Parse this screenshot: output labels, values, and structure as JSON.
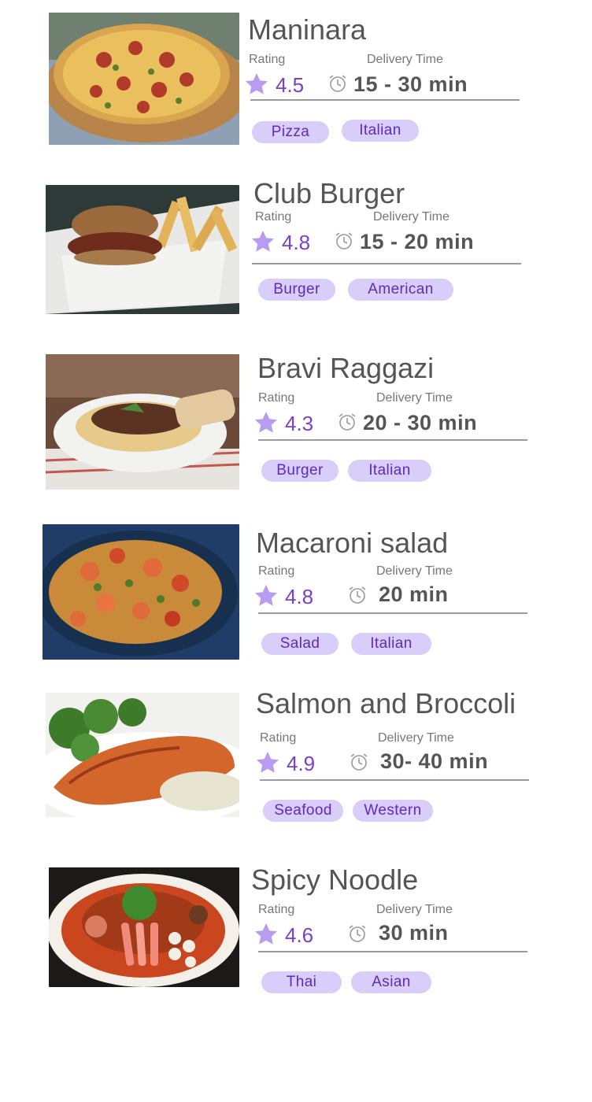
{
  "labels": {
    "rating": "Rating",
    "delivery": "Delivery Time"
  },
  "colors": {
    "accent": "#7a3fd0",
    "star": "#b79cf2",
    "tag_bg": "#d9cdfa",
    "tag_text": "#5d2cb8",
    "title": "#555555"
  },
  "restaurants": [
    {
      "name": "Maninara",
      "rating": "4.5",
      "delivery": "15 - 30 min",
      "tags": [
        "Pizza",
        "Italian"
      ],
      "image": "pizza-photo"
    },
    {
      "name": "Club Burger",
      "rating": "4.8",
      "delivery": "15 - 20 min",
      "tags": [
        "Burger",
        "American"
      ],
      "image": "burger-photo"
    },
    {
      "name": "Bravi Raggazi",
      "rating": "4.3",
      "delivery": "20 - 30 min",
      "tags": [
        "Burger",
        "Italian"
      ],
      "image": "pasta-photo"
    },
    {
      "name": "Macaroni salad",
      "rating": "4.8",
      "delivery": "20 min",
      "tags": [
        "Salad",
        "Italian"
      ],
      "image": "paella-photo"
    },
    {
      "name": "Salmon and Broccoli",
      "rating": "4.9",
      "delivery": "30- 40 min",
      "tags": [
        "Seafood",
        "Western"
      ],
      "image": "salmon-photo"
    },
    {
      "name": "Spicy Noodle",
      "rating": "4.6",
      "delivery": "30 min",
      "tags": [
        "Thai",
        "Asian"
      ],
      "image": "noodle-photo"
    }
  ]
}
